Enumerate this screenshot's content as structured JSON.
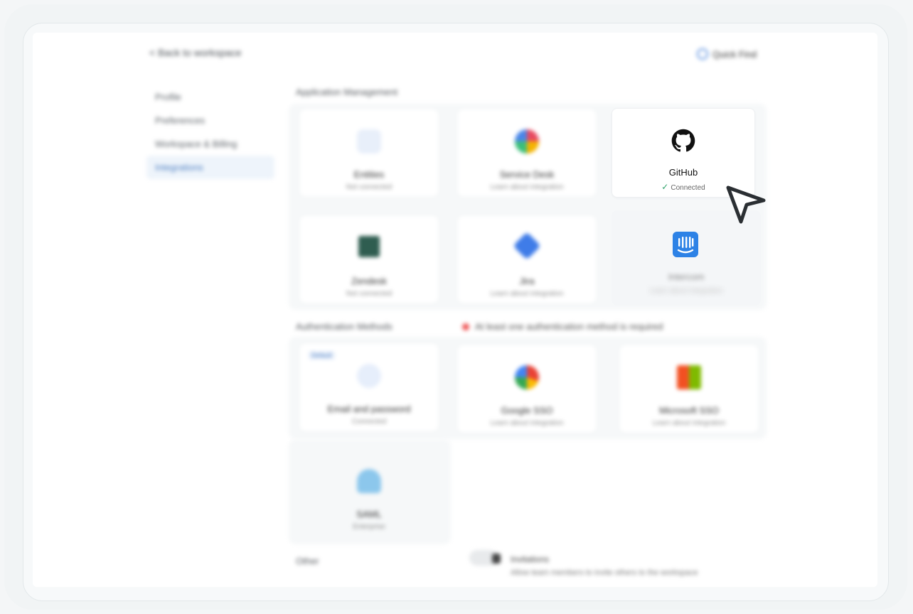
{
  "header": {
    "breadcrumb": "< Back to workspace",
    "search_label": "Quick Find"
  },
  "sidebar": {
    "items": [
      {
        "label": "Profile"
      },
      {
        "label": "Preferences"
      },
      {
        "label": "Workspace & Billing"
      },
      {
        "label": "Integrations"
      }
    ]
  },
  "sections": {
    "apps_title": "Application Management",
    "auth_title": "Authentication Methods",
    "auth_warning": "At least one authentication method is required",
    "other_title": "Other"
  },
  "apps": [
    {
      "name": "Entities",
      "sub": "Not connected",
      "icon": "app-icon"
    },
    {
      "name": "Service Desk",
      "sub": "Learn about integration",
      "icon": "pinwheel-icon"
    },
    {
      "name": "GitHub",
      "sub": "Connected",
      "icon": "github-icon"
    },
    {
      "name": "Zendesk",
      "sub": "Not connected",
      "icon": "zendesk-icon"
    },
    {
      "name": "Jira",
      "sub": "Learn about integration",
      "icon": "jira-icon"
    },
    {
      "name": "Intercom",
      "sub": "Learn about integration",
      "icon": "intercom-icon"
    }
  ],
  "auth": [
    {
      "name": "Email and password",
      "sub": "Connected",
      "icon": "email-icon",
      "badge": "Default"
    },
    {
      "name": "Google SSO",
      "sub": "Learn about integration",
      "icon": "google-icon"
    },
    {
      "name": "Microsoft SSO",
      "sub": "Learn about integration",
      "icon": "microsoft-icon"
    },
    {
      "name": "SAML",
      "sub": "Enterprise",
      "icon": "saml-icon"
    }
  ],
  "other": {
    "toggle_label": "Invitations",
    "toggle_desc": "Allow team members to invite others to the workspace"
  },
  "colors": {
    "accent": "#4d7fc1",
    "connected": "#2fa36b",
    "intercom": "#2d82e6"
  }
}
